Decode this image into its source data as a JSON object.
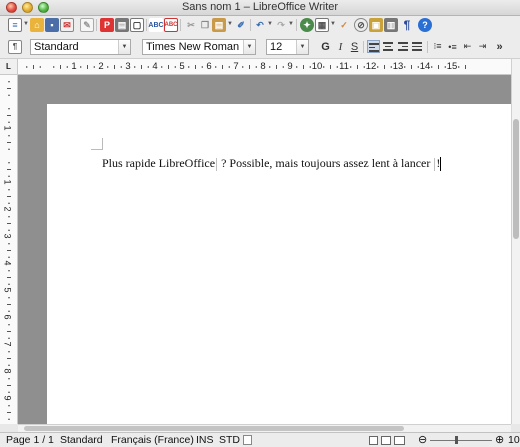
{
  "window": {
    "title": "Sans nom 1 – LibreOffice Writer"
  },
  "toolbar_standard": {
    "icons": [
      "new-document-icon",
      "open-icon",
      "save-icon",
      "email-icon",
      "edit-file-icon",
      "export-pdf-icon",
      "print-icon",
      "page-preview-icon",
      "spellcheck-icon",
      "autospellcheck-icon",
      "cut-icon",
      "copy-icon",
      "paste-icon",
      "clone-formatting-icon",
      "undo-icon",
      "redo-icon",
      "navigator-icon",
      "table-icon",
      "draw-functions-icon",
      "gallery-icon",
      "image-icon",
      "chart-icon",
      "formatting-marks-icon",
      "help-icon"
    ]
  },
  "toolbar_formatting": {
    "paragraph_style": "Standard",
    "font_name": "Times New Roman",
    "font_size": "12",
    "bold_label": "G",
    "italic_label": "I",
    "underline_label": "S",
    "overflow_label": "»"
  },
  "ruler": {
    "corner_label": "L",
    "horizontal_numbers": [
      "1",
      "2",
      "3",
      "4",
      "5",
      "6",
      "7",
      "8",
      "9",
      "10",
      "11",
      "12",
      "13",
      "14",
      "15"
    ],
    "vertical_numbers": [
      "1",
      "1",
      "2",
      "3",
      "4",
      "5",
      "6",
      "7",
      "8",
      "9"
    ]
  },
  "document": {
    "text_before_field": "Plus rapide LibreOffice",
    "text_after_field": " ? Possible, mais toujours assez lent à lancer ",
    "text_end": "!"
  },
  "status_bar": {
    "page": "Page 1 / 1",
    "page_style": "Standard",
    "language": "Français (France)",
    "insert_mode": "INS",
    "selection_mode": "STD",
    "zoom_partial": "10"
  }
}
